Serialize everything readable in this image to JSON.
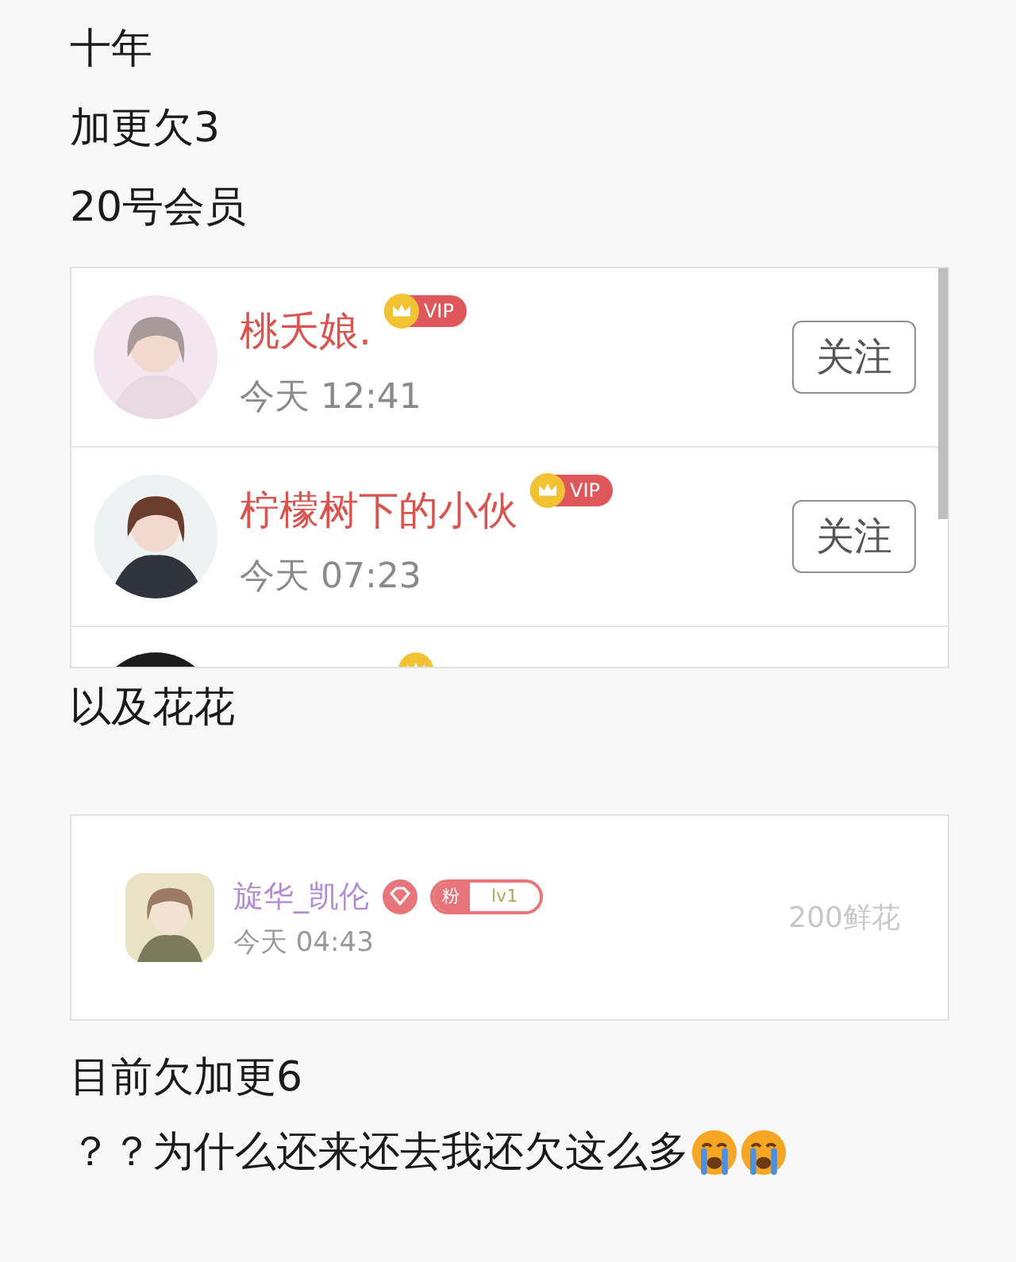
{
  "intro_lines": [
    "十年",
    "加更欠3",
    "20号会员"
  ],
  "member_list": {
    "rows": [
      {
        "kind": "member",
        "name": "桃夭娘.",
        "badge": "VIP",
        "time": "今天 12:41",
        "button": "关注"
      },
      {
        "kind": "member",
        "name": "柠檬树下的小伙",
        "badge": "VIP",
        "time": "今天 07:23",
        "button": "关注"
      },
      {
        "kind": "partial"
      }
    ]
  },
  "middle_line": "以及花花",
  "gift_card": {
    "name": "旋华_凯伦",
    "fan_badge": "粉",
    "fan_level": "lv1",
    "time": "今天 04:43",
    "gift": "200鲜花"
  },
  "closing_lines": [
    "目前欠加更6",
    "？？为什么还来还去我还欠这么多"
  ]
}
